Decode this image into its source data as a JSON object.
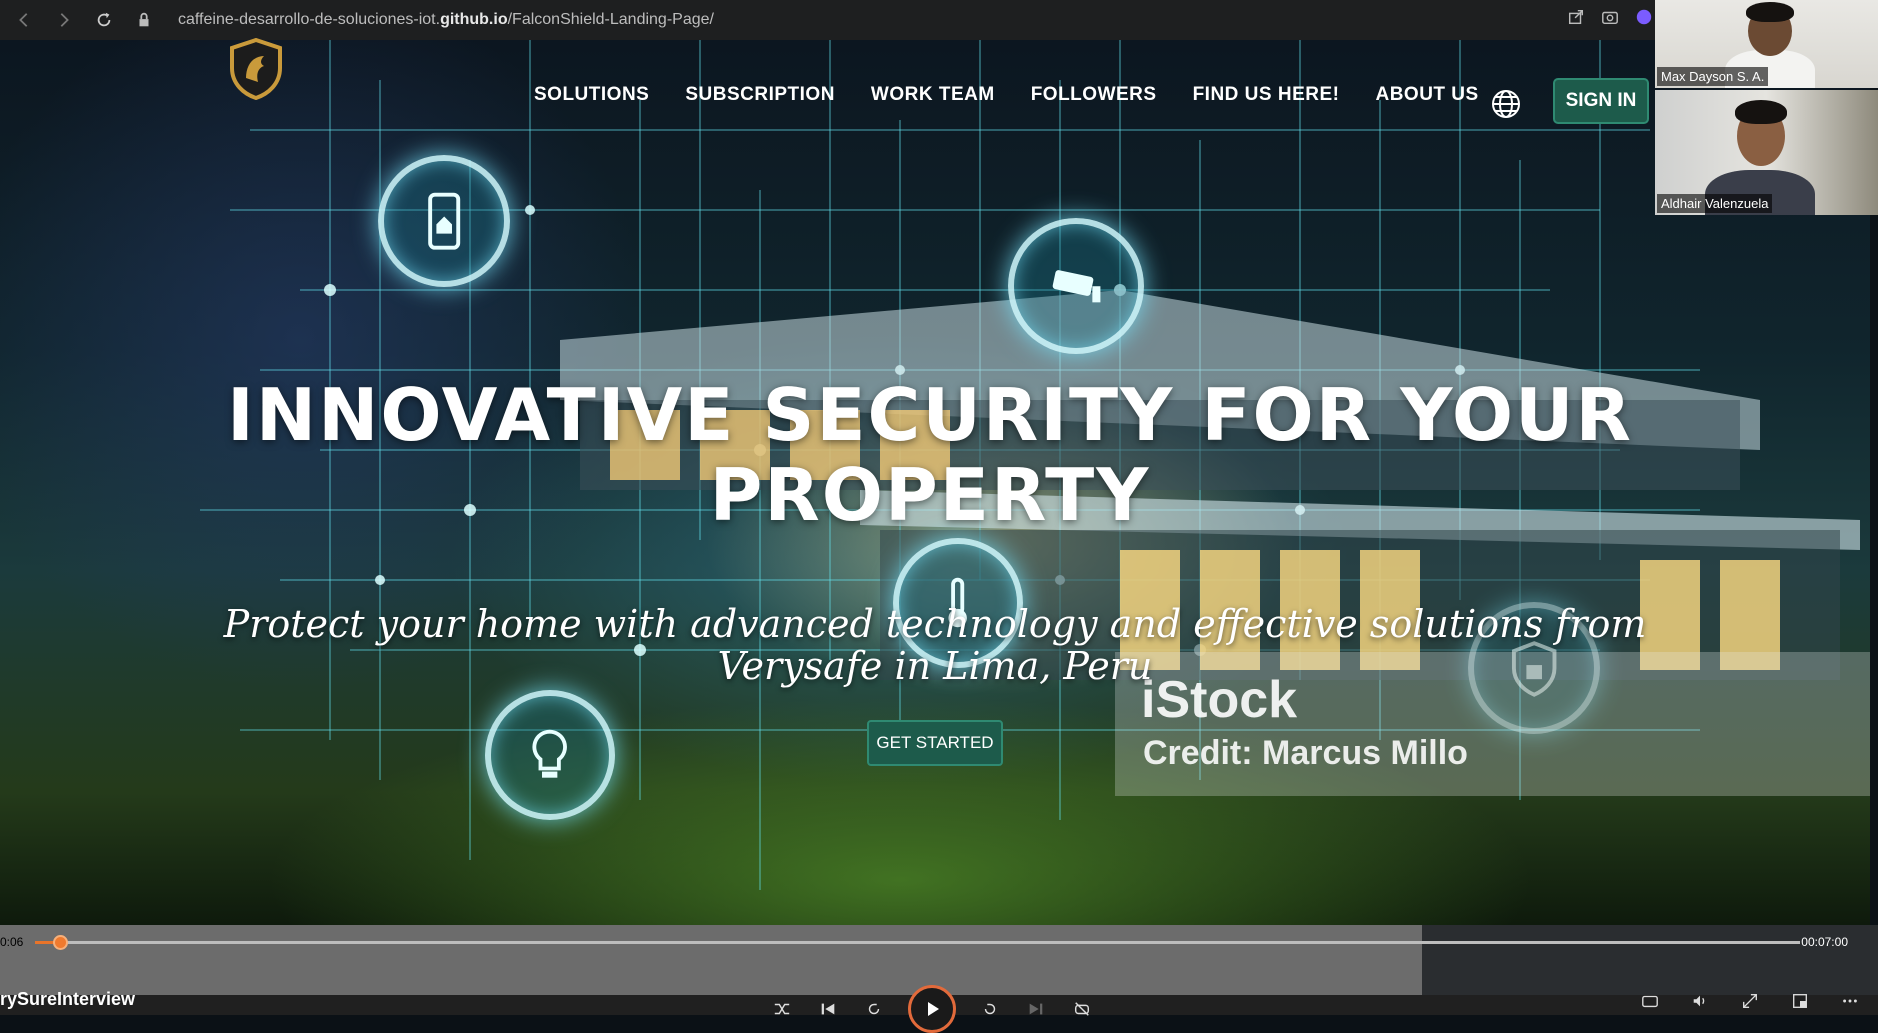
{
  "browser": {
    "url_prefix": "caffeine-desarrollo-de-soluciones-iot.",
    "url_host": "github.io",
    "url_path": "/FalconShield-Landing-Page/"
  },
  "nav": {
    "items": [
      "SOLUTIONS",
      "SUBSCRIPTION",
      "WORK TEAM",
      "FOLLOWERS",
      "FIND US HERE!",
      "ABOUT US"
    ],
    "signin": "SIGN IN"
  },
  "hero": {
    "headline": "INNOVATIVE SECURITY FOR YOUR PROPERTY",
    "subheadline": "Protect your home with advanced technology and effective solutions from Verysafe in Lima, Peru",
    "cta": "GET STARTED",
    "watermark_brand": "iStock",
    "watermark_credit": "Credit: Marcus Millo"
  },
  "participants": [
    {
      "name": "Max Dayson S. A."
    },
    {
      "name": "Aldhair Valenzuela"
    }
  ],
  "player": {
    "current_time": "0:06",
    "total_time": "00:07:00",
    "progress": 0.014,
    "title": "rySureInterview"
  },
  "colors": {
    "accent_button": "#1d5b4b",
    "progress": "#f07a2e"
  }
}
